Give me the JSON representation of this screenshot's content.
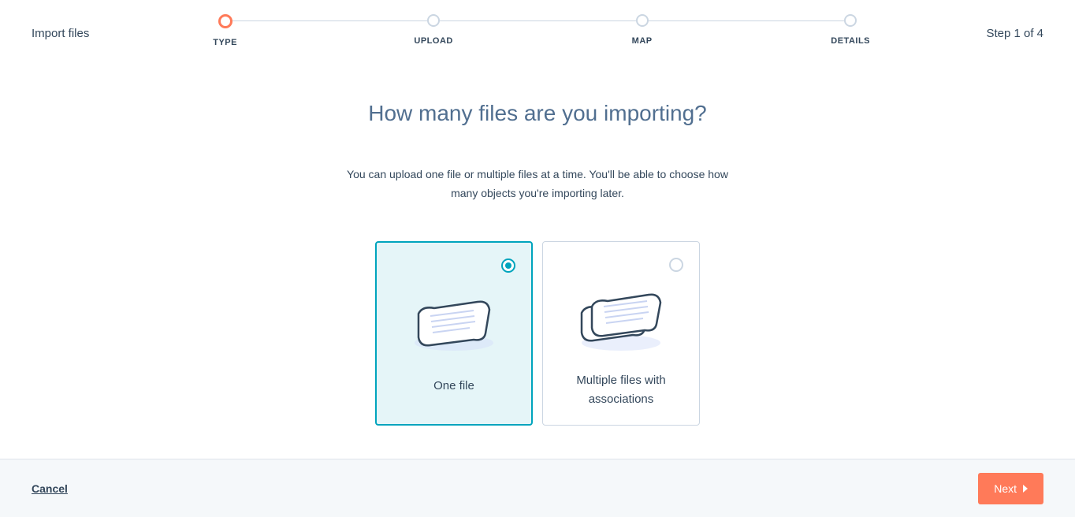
{
  "header": {
    "page_label": "Import files",
    "step_counter": "Step 1 of 4",
    "steps": [
      {
        "label": "TYPE",
        "active": true
      },
      {
        "label": "UPLOAD",
        "active": false
      },
      {
        "label": "MAP",
        "active": false
      },
      {
        "label": "DETAILS",
        "active": false
      }
    ]
  },
  "main": {
    "title": "How many files are you importing?",
    "subtitle": "You can upload one file or multiple files at a time. You'll be able to choose how many objects you're importing later."
  },
  "cards": [
    {
      "label": "One file",
      "selected": true
    },
    {
      "label": "Multiple files with associations",
      "selected": false
    }
  ],
  "footer": {
    "cancel_label": "Cancel",
    "next_label": "Next"
  }
}
